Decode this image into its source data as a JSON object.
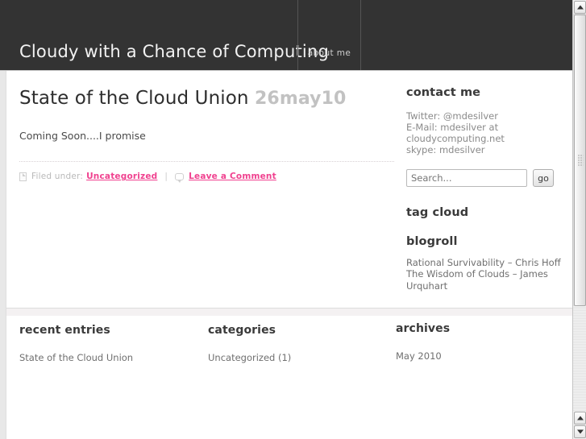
{
  "header": {
    "site_title": "Cloudy with a Chance of Computing",
    "nav": [
      {
        "label": "about me"
      }
    ]
  },
  "post": {
    "title": "State of the Cloud Union",
    "date": "26may10",
    "body": "Coming Soon....I promise",
    "meta": {
      "filed_under_label": "Filed under:",
      "category": "Uncategorized",
      "divider": "|",
      "comment_link": "Leave a Comment"
    }
  },
  "sidebar": {
    "contact": {
      "heading": "contact me",
      "twitter": "Twitter: @mdesilver",
      "email_line1": "E-Mail: mdesilver at",
      "email_line2": "cloudycomputing.net",
      "skype": "skype: mdesilver"
    },
    "search": {
      "placeholder": "Search...",
      "value": "",
      "button_label": "go"
    },
    "tag_cloud": {
      "heading": "tag cloud"
    },
    "blogroll": {
      "heading": "blogroll",
      "links": [
        "Rational Survivability – Chris Hoff",
        "The Wisdom of Clouds – James Urquhart"
      ]
    }
  },
  "footer": {
    "recent_entries": {
      "heading": "recent entries",
      "items": [
        "State of the Cloud Union"
      ]
    },
    "categories": {
      "heading": "categories",
      "items": [
        "Uncategorized (1)"
      ]
    },
    "archives": {
      "heading": "archives",
      "items": [
        "May 2010"
      ]
    }
  },
  "colors": {
    "header_bg": "#333333",
    "accent_pink": "#f0418f",
    "date_gray": "#c2c2c2",
    "body_text": "#4a4a4a"
  }
}
